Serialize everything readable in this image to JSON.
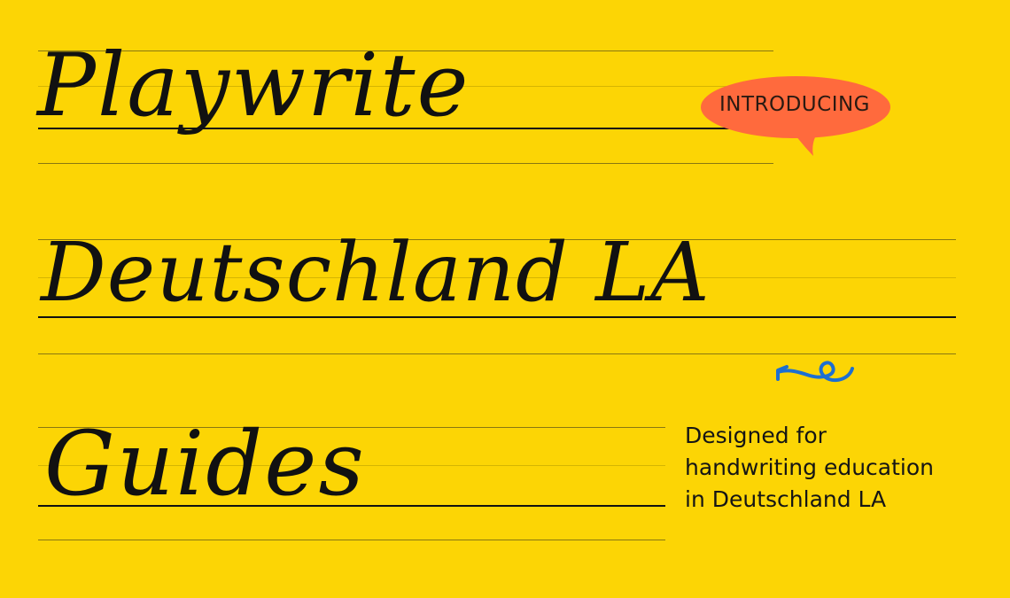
{
  "colors": {
    "background": "#FCD505",
    "bubble": "#FF6A3D",
    "accent_arrow": "#1D6FD1",
    "ink": "#111111"
  },
  "headline": {
    "line1": "Playwrite",
    "line2": "Deutschland LA",
    "line3": "Guides"
  },
  "badge": {
    "label": "INTRODUCING"
  },
  "tagline": {
    "line1": "Designed for",
    "line2": "handwriting education",
    "line3": "in Deutschland LA"
  },
  "icons": {
    "bubble": "speech-bubble-icon",
    "arrow": "curly-arrow-icon"
  }
}
